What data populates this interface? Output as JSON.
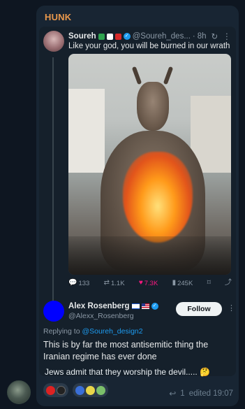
{
  "message": {
    "sender": "HUNK",
    "caption": "Jews admit that they worship the devil.....",
    "caption_emoji": "🤔",
    "reply_count": "1",
    "status": "edited 19:07"
  },
  "embedded_post": {
    "author_name": "Soureh",
    "author_handle": "@Soureh_des...",
    "dot": "·",
    "time": "8h",
    "text": "Like your god, you will be burned in our wrath",
    "actions": {
      "replies": "133",
      "reposts": "1.1K",
      "likes": "7.3K",
      "views": "245K"
    }
  },
  "reply_post": {
    "author_name": "Alex Rosenberg",
    "author_handle": "@Alexx_Rosenberg",
    "follow_label": "Follow",
    "replying_prefix": "Replying to",
    "replying_to": "@Soureh_design2",
    "text": "This is by far the most antisemitic thing the Iranian regime has ever done"
  },
  "icons": {
    "reply": "reply-icon",
    "repost": "repost-icon",
    "like": "heart-icon",
    "views": "views-icon",
    "bookmark": "bookmark-icon",
    "share": "share-icon",
    "verified": "verified-icon"
  },
  "colors": {
    "sender": "#e9984c",
    "link": "#1d9bf0",
    "like": "#f91880",
    "bubble": "#182533",
    "background": "#0e1621"
  }
}
